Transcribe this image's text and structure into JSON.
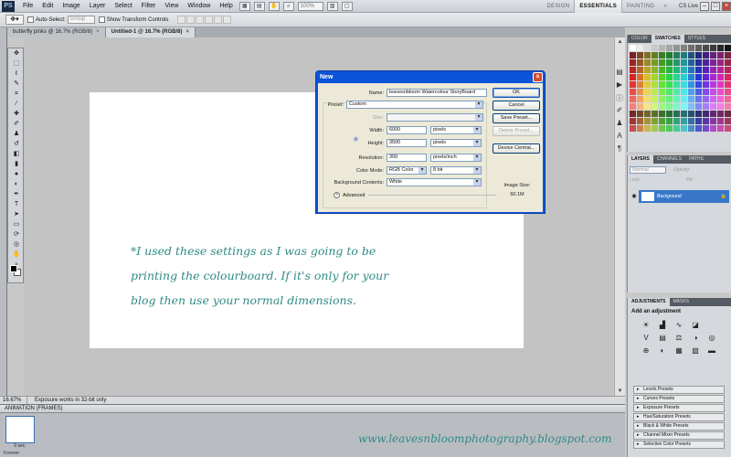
{
  "menubar": {
    "logo": "PS",
    "items": [
      "File",
      "Edit",
      "Image",
      "Layer",
      "Select",
      "Filter",
      "View",
      "Window",
      "Help"
    ],
    "zoom": "100%",
    "workspaces": [
      "DESIGN",
      "ESSENTIALS",
      "PAINTING"
    ],
    "more": "»",
    "cs_live": "CS Live"
  },
  "options": {
    "auto_select": "Auto-Select:",
    "auto_select_value": "Group",
    "show_transform": "Show Transform Controls"
  },
  "tabs": [
    {
      "label": "butterfly pinks @ 16.7% (RGB/8)",
      "close": "×"
    },
    {
      "label": "Untitled-1 @ 16.7% (RGB/8)",
      "close": "×"
    }
  ],
  "dialog": {
    "title": "New",
    "close": "×",
    "name_label": "Name:",
    "name_value": "leavesnbloom Watercolour StoryBoard",
    "preset_label": "Preset:",
    "preset_value": "Custom",
    "size_label": "Size:",
    "width_label": "Width:",
    "width_value": "6000",
    "width_unit": "pixels",
    "height_label": "Height:",
    "height_value": "3500",
    "height_unit": "pixels",
    "resolution_label": "Resolution:",
    "resolution_value": "300",
    "resolution_unit": "pixels/inch",
    "color_mode_label": "Color Mode:",
    "color_mode_value": "RGB Color",
    "bit_depth": "8 bit",
    "bg_label": "Background Contents:",
    "bg_value": "White",
    "advanced_label": "Advanced",
    "ok": "OK",
    "cancel": "Cancel",
    "save_preset": "Save Preset...",
    "delete_preset": "Delete Preset...",
    "device_central": "Device Central...",
    "image_size_label": "Image Size:",
    "image_size_value": "60.1M"
  },
  "canvas_note": {
    "line1": "*I used these settings as I was going to be",
    "line2": "printing the colourboard.  If it's only for your",
    "line3": "blog then use your normal dimensions."
  },
  "status": {
    "zoom": "16.67%",
    "message": "Exposure works in 32-bit only"
  },
  "animation": {
    "title": "ANIMATION (FRAMES)",
    "frame_time": "0 sec.",
    "loop": "Forever"
  },
  "watermark": "www.leavesnbloomphotography.blogspot.com",
  "panels": {
    "color_tabs": [
      "COLOR",
      "SWATCHES",
      "STYLES"
    ],
    "layers_tabs": [
      "LAYERS",
      "CHANNELS",
      "PATHS"
    ],
    "blend_mode": "Normal",
    "opacity": "Opacity:",
    "lock": "Lock:",
    "fill": "Fill:",
    "layer_name": "Background",
    "adj_tabs": [
      "ADJUSTMENTS",
      "MASKS"
    ],
    "adj_title": "Add an adjustment",
    "presets": [
      "Levels Presets",
      "Curves Presets",
      "Exposure Presets",
      "Hue/Saturation Presets",
      "Black & White Presets",
      "Channel Mixer Presets",
      "Selective Color Presets"
    ]
  },
  "colors": {
    "accent": "#0b54d8",
    "note_teal": "#2f8a86",
    "layer_selected": "#3877c8"
  }
}
